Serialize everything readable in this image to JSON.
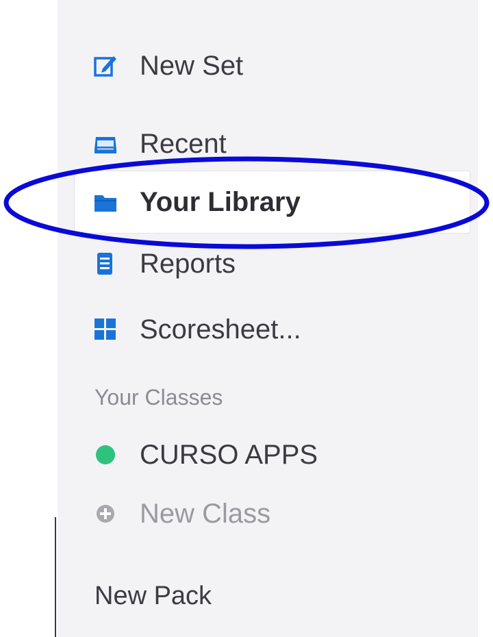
{
  "sidebar": {
    "new_set": {
      "label": "New Set",
      "icon": "edit-square-icon"
    },
    "recent": {
      "label": "Recent",
      "icon": "inbox-tray-icon"
    },
    "library": {
      "label": "Your Library",
      "icon": "folder-icon"
    },
    "reports": {
      "label": "Reports",
      "icon": "report-icon"
    },
    "scoresheet": {
      "label": "Scoresheet...",
      "icon": "grid-icon"
    },
    "classes_heading": "Your Classes",
    "class_item": {
      "label": "CURSO APPS",
      "dot_color": "#2ec27e"
    },
    "new_class": {
      "label": "New Class",
      "icon": "plus-circle-icon"
    },
    "new_pack": "New Pack"
  },
  "colors": {
    "icon_blue": "#1a73d9",
    "annotation_blue": "#0a0ad8",
    "sidebar_bg": "#f3f3f6"
  }
}
